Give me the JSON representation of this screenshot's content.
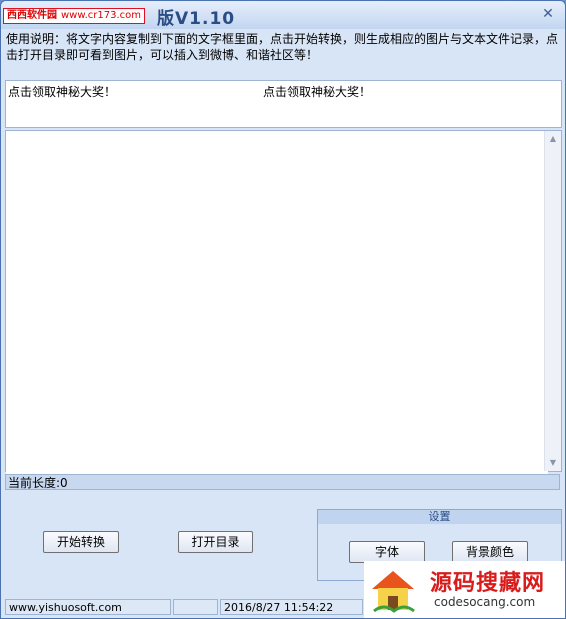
{
  "window": {
    "title": "版V1.10",
    "watermark_left": "西西软件园",
    "watermark_right": "www.cr173.com",
    "close_glyph": "✕"
  },
  "instructions": "使用说明：将文字内容复制到下面的文字框里面，点击开始转换，则生成相应的图片与文本文件记录，点击打开目录即可看到图片，可以插入到微博、和谐社区等！",
  "preview": {
    "text_left": "点击领取神秘大奖！",
    "text_right": "点击领取神秘大奖！"
  },
  "editor": {
    "value": ""
  },
  "status": {
    "length_text": "当前长度:0"
  },
  "buttons": {
    "start": "开始转换",
    "open_dir": "打开目录"
  },
  "settings": {
    "header": "设置",
    "font_button": "字体",
    "bgcolor_button": "背景颜色"
  },
  "statusbar": {
    "website": "www.yishuosoft.com",
    "datetime": "2016/8/27 11:54:22"
  },
  "logo": {
    "main": "源码搜藏网",
    "sub": "codesocang.com"
  },
  "colors": {
    "accent": "#2b4d86",
    "logo_red": "#d81c1c"
  }
}
